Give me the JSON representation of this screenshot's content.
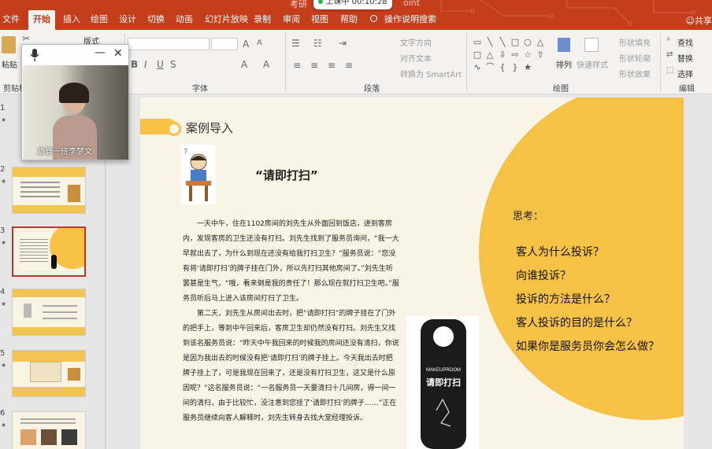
{
  "ribbon_tabs": [
    "文件",
    "开始",
    "插入",
    "绘图",
    "设计",
    "切换",
    "动画",
    "幻灯片放映",
    "录制",
    "审阅",
    "视图",
    "帮助"
  ],
  "active_tab": "开始",
  "tell_me": "操作说明搜索",
  "share": "共享",
  "timer": "上课中 00:10:28",
  "title_left": "考研",
  "title_right": "oint",
  "ribbon": {
    "paste": "粘贴",
    "clipboard": "剪贴板",
    "layout": "版式",
    "font_group": "字体",
    "paragraph_group": "段落",
    "drawing_group": "绘图",
    "editing_group": "编辑",
    "text_direction": "文字方向",
    "align_text": "对齐文本",
    "smartart": "转换为 SmartArt",
    "arrange": "排列",
    "quick_styles": "快速样式",
    "shape_fill": "形状填充",
    "shape_outline": "形状轮廓",
    "shape_effects": "形状效果",
    "find": "查找",
    "replace": "替换",
    "select": "选择"
  },
  "thumbnails": [
    {
      "num": "1"
    },
    {
      "num": "2"
    },
    {
      "num": "3"
    },
    {
      "num": "4"
    },
    {
      "num": "5"
    },
    {
      "num": "6"
    }
  ],
  "video": {
    "label": "酒管一班李梦文"
  },
  "slide": {
    "heading": "案例导入",
    "story_title": "“请即打扫”",
    "paragraphs": [
      "一天中午，住在1102房间的刘先生从外面回到饭店，进到客房内，发现客房的卫生还没有打扫。刘先生找到了服务员询问，“我一大早就出去了，为什么到现在还没有给我打扫卫生？”服务员说：“您没有将‘请即打扫’的牌子挂在门外，所以先打扫其他房间了。”刘先生听罢甚是生气，“哦，看来倒是我的责任了！那么现在就打扫卫生吧。”服务员听后马上进入该房间打扫了卫生。",
      "第二天，刘先生从房间出去时，把“请即打扫”的牌子挂在了门外的把手上，等到中午回来后，客房卫生却仍然没有打扫。刘先生又找到该名服务员说：“昨天中午我回来的时候我的房间还没有清扫，你说是因为我出去的时候没有把‘请即打扫’的牌子挂上。今天我出去时把牌子挂上了，可是我现在回来了，还是没有打扫卫生，这又是什么原因呢？”这名服务员说：“一名服务员一天要清扫十几间房，得一间一间的清扫，由于比较忙，没注意到您挂了‘请即打扫’的牌子……”正在服务员继续向客人解释时，刘先生转身去找大堂经理投诉。"
    ],
    "think_title": "思考：",
    "questions": [
      "客人为什么投诉？",
      "向谁投诉？",
      "投诉的方法是什么？",
      "客人投诉的目的是什么？",
      "如果你是服务员你会怎么做？"
    ],
    "hanger_en": "MAKEUPROOM",
    "hanger_cn": "请即打扫"
  },
  "colors": {
    "title_bar": "#c43e1c",
    "accent_yellow": "#f5c245",
    "slide_bg": "#faf4e6",
    "selected_thumb": "#b13a2c"
  }
}
